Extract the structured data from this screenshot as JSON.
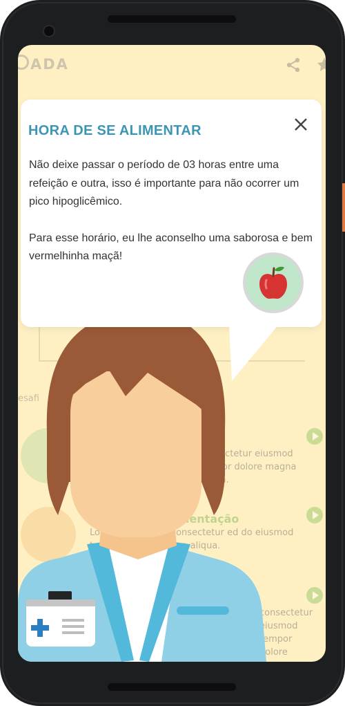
{
  "app": {
    "title": "ADA"
  },
  "background_list": {
    "section_label": "esafi",
    "items": [
      {
        "title": "",
        "desc": "consectetur eiusmod tempor dolore magna aliqua."
      },
      {
        "title": "alimentação",
        "desc": "Lo dolor sit amet, consectetur ed do eiusmod tempor dolore magna aliqua."
      },
      {
        "title": "",
        "desc": "consectetur eiusmod tempor dolore magna aliqua."
      }
    ]
  },
  "dialog": {
    "title": "HORA DE SE ALIMENTAR",
    "paragraph_1": "Não deixe passar o período de 03 horas entre uma refeição e outra, isso é importante para não ocorrer um pico hipoglicêmico.",
    "paragraph_2": "Para esse horário, eu lhe aconselho uma saborosa e bem vermelhinha maçã!"
  },
  "icons": {
    "close": "close-icon",
    "apple": "apple-icon",
    "share": "share-icon",
    "star": "star-icon",
    "play": "play-icon",
    "medical_kit": "medical-kit-icon"
  },
  "colors": {
    "screen_background": "#fff0c4",
    "dialog_title": "#3d95b5",
    "apple_badge": "#bfe6c9",
    "apple": "#d63333",
    "hair": "#9a5a37",
    "skin": "#f8cf9c",
    "coat": "#8fd0e6"
  }
}
